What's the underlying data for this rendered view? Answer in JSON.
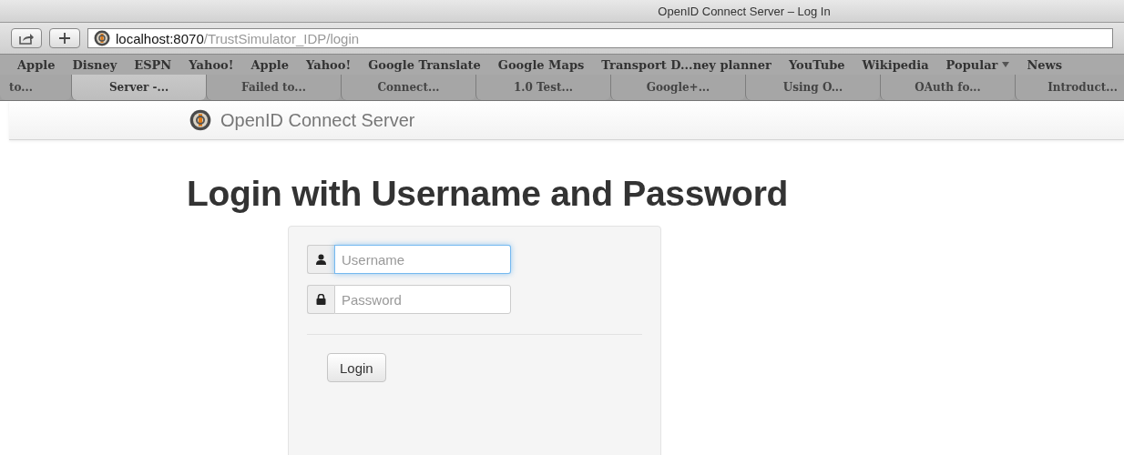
{
  "window": {
    "title": "OpenID Connect Server – Log In"
  },
  "toolbar": {
    "address": {
      "host": "localhost:8070",
      "path": "/TrustSimulator_IDP/login"
    }
  },
  "bookmarks": [
    {
      "label": "Apple",
      "kind": "link"
    },
    {
      "label": "Disney",
      "kind": "link"
    },
    {
      "label": "ESPN",
      "kind": "link"
    },
    {
      "label": "Yahoo!",
      "kind": "link"
    },
    {
      "label": "Apple",
      "kind": "link"
    },
    {
      "label": "Yahoo!",
      "kind": "link"
    },
    {
      "label": "Google Translate",
      "kind": "link"
    },
    {
      "label": "Google Maps",
      "kind": "link"
    },
    {
      "label": "Transport D...ney planner",
      "kind": "link"
    },
    {
      "label": "YouTube",
      "kind": "link"
    },
    {
      "label": "Wikipedia",
      "kind": "link"
    },
    {
      "label": "Popular",
      "kind": "menu"
    },
    {
      "label": "News",
      "kind": "link"
    }
  ],
  "tabs": [
    {
      "label": "to...",
      "selected": false
    },
    {
      "label": "Server -...",
      "selected": true
    },
    {
      "label": "Failed to...",
      "selected": false
    },
    {
      "label": "Connect...",
      "selected": false
    },
    {
      "label": "1.0 Test...",
      "selected": false
    },
    {
      "label": "Google+...",
      "selected": false
    },
    {
      "label": "Using O...",
      "selected": false
    },
    {
      "label": "OAuth fo...",
      "selected": false
    },
    {
      "label": "Introduct...",
      "selected": false
    }
  ],
  "navbar": {
    "brand": "OpenID Connect Server"
  },
  "heading": "Login with Username and Password",
  "form": {
    "fields": [
      {
        "kind": "user",
        "placeholder": "Username",
        "focused": true
      },
      {
        "kind": "password",
        "placeholder": "Password",
        "focused": false
      }
    ],
    "button": "Login"
  }
}
